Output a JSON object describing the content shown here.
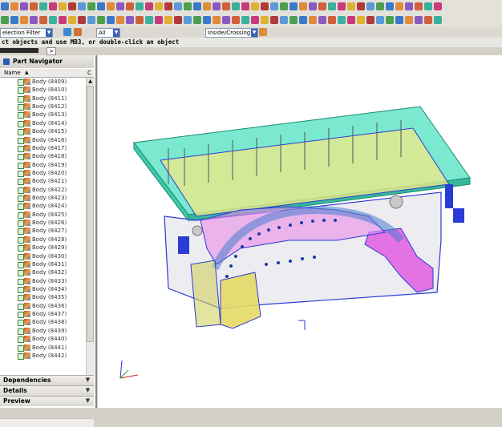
{
  "selection_bar": {
    "filter_value": "election Filter",
    "scope_value": "All",
    "select_mode": "Inside/Crossing"
  },
  "cue_line": "ct objects and use MB3, or double-click an object",
  "tab_arrow": ">",
  "navigator": {
    "title": "Part Navigator",
    "col_name": "Name",
    "col_c": "C",
    "items": [
      "Body (8409)",
      "Body (8410)",
      "Body (8411)",
      "Body (8412)",
      "Body (8413)",
      "Body (8414)",
      "Body (8415)",
      "Body (8416)",
      "Body (8417)",
      "Body (8418)",
      "Body (8419)",
      "Body (8420)",
      "Body (8421)",
      "Body (8422)",
      "Body (8423)",
      "Body (8424)",
      "Body (8425)",
      "Body (8426)",
      "Body (8427)",
      "Body (8428)",
      "Body (8429)",
      "Body (8430)",
      "Body (8431)",
      "Body (8432)",
      "Body (8433)",
      "Body (8434)",
      "Body (8435)",
      "Body (8436)",
      "Body (8437)",
      "Body (8438)",
      "Body (8439)",
      "Body (8440)",
      "Body (8441)",
      "Body (8442)"
    ]
  },
  "panels": {
    "dependencies": "Dependencies",
    "details": "Details",
    "preview": "Preview"
  },
  "colors": {
    "plate_top": "#4fe0c0",
    "plate_mid": "#e8e88a",
    "outline": "#2b3cd6",
    "magenta": "#e04ae0",
    "selection": "#3b61b8"
  }
}
